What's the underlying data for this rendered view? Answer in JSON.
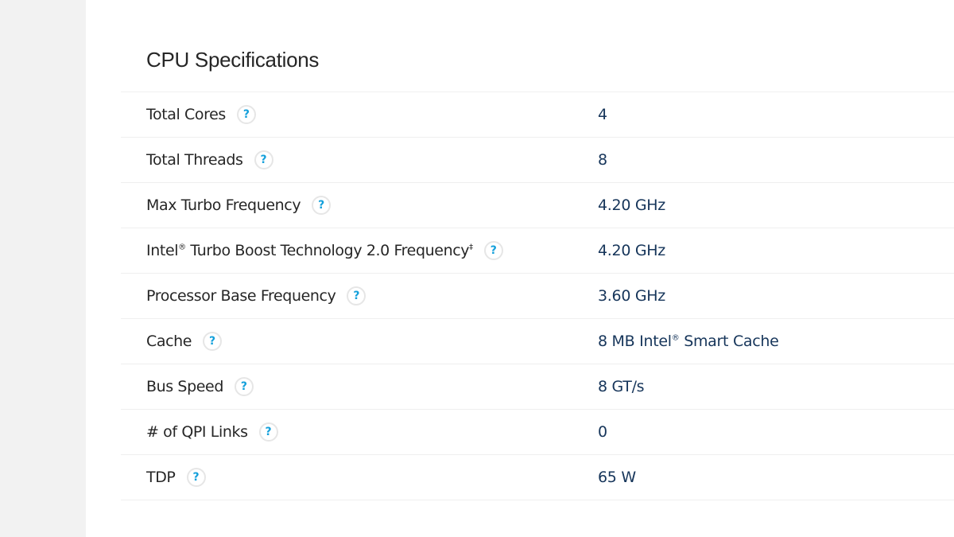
{
  "section": {
    "title": "CPU Specifications"
  },
  "specs": [
    {
      "label": "Total Cores",
      "value": "4"
    },
    {
      "label": "Total Threads",
      "value": "8"
    },
    {
      "label": "Max Turbo Frequency",
      "value": "4.20 GHz"
    },
    {
      "label": "Intel® Turbo Boost Technology 2.0 Frequency‡",
      "value": "4.20 GHz"
    },
    {
      "label": "Processor Base Frequency",
      "value": "3.60 GHz"
    },
    {
      "label": "Cache",
      "value": "8 MB Intel® Smart Cache"
    },
    {
      "label": "Bus Speed",
      "value": "8 GT/s"
    },
    {
      "label": "# of QPI Links",
      "value": "0"
    },
    {
      "label": "TDP",
      "value": "65 W"
    }
  ],
  "help_icon_glyph": "?",
  "colors": {
    "help_icon": "#14a0db",
    "value_text": "#16355a",
    "label_text": "#262626",
    "side_panel": "#f2f2f2"
  }
}
